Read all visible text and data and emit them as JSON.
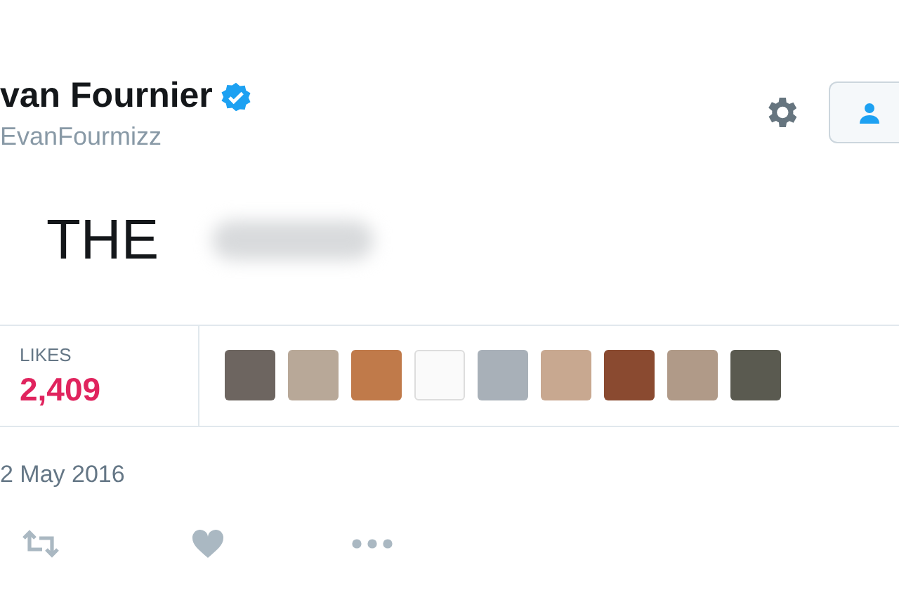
{
  "author": {
    "name": "van Fournier",
    "verified": true,
    "handle": "EvanFourmizz"
  },
  "tweet": {
    "text": "THE",
    "blurred": true
  },
  "stats": {
    "label": "LIKES",
    "value": "2,409"
  },
  "likers": [
    {
      "kind": "photo"
    },
    {
      "kind": "photo"
    },
    {
      "kind": "photo"
    },
    {
      "kind": "document"
    },
    {
      "kind": "photo"
    },
    {
      "kind": "photo"
    },
    {
      "kind": "photo"
    },
    {
      "kind": "photo"
    },
    {
      "kind": "photo"
    }
  ],
  "date": "2 May 2016"
}
